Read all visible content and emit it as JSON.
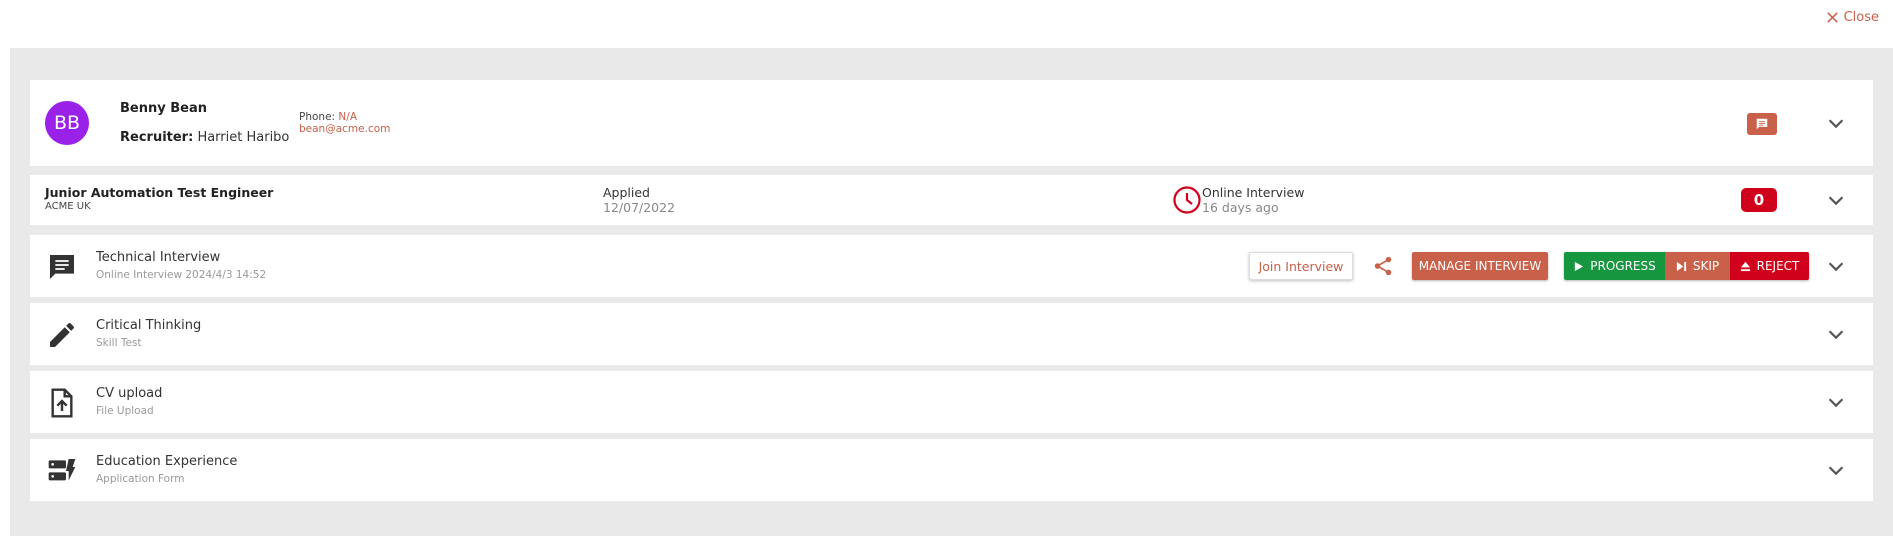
{
  "header": {
    "close_label": "Close"
  },
  "candidate": {
    "initials": "BB",
    "name": "Benny Bean",
    "recruiter_label": "Recruiter:",
    "recruiter_name": "Harriet Haribo",
    "phone_label": "Phone:",
    "phone_value": "N/A",
    "email": "bean@acme.com"
  },
  "job": {
    "title": "Junior Automation Test Engineer",
    "company": "ACME UK",
    "status_label": "Applied",
    "status_date": "12/07/2022",
    "stage_label": "Online Interview",
    "stage_time": "16 days ago",
    "count": "0"
  },
  "steps": [
    {
      "title": "Technical Interview",
      "subtitle": "Online Interview 2024/4/3 14:52",
      "icon": "chat-bubble-icon"
    },
    {
      "title": "Critical Thinking",
      "subtitle": "Skill Test",
      "icon": "pencil-icon"
    },
    {
      "title": "CV upload",
      "subtitle": "File Upload",
      "icon": "file-upload-icon"
    },
    {
      "title": "Education Experience",
      "subtitle": "Application Form",
      "icon": "dynamic-form-icon"
    }
  ],
  "actions": {
    "join_label": "Join Interview",
    "manage_label": "MANAGE INTERVIEW",
    "progress_label": "PROGRESS",
    "skip_label": "SKIP",
    "reject_label": "REJECT"
  },
  "colors": {
    "accent": "#c9604a",
    "avatar": "#9a22e8",
    "progress": "#15963f",
    "reject": "#d0021b",
    "panel_bg": "#e9e9e9"
  }
}
